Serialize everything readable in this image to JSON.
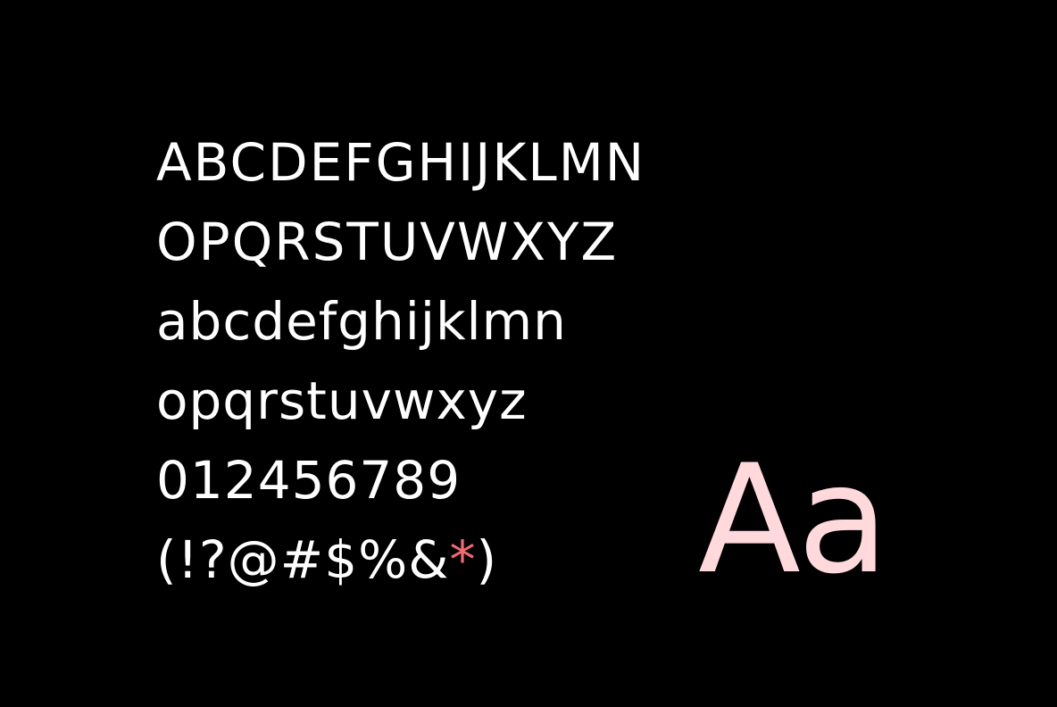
{
  "colors": {
    "background": "#000000",
    "text": "#ffffff",
    "accent": "#f26b73",
    "sample": "#ffd9dc"
  },
  "charset": {
    "uppercase_1": "ABCDEFGHIJKLMN",
    "uppercase_2": "OPQRSTUVWXYZ",
    "lowercase_1": "abcdefghijklmn",
    "lowercase_2": "opqrstuvwxyz",
    "digits": "012456789",
    "symbols_before": "(!?@#$%&",
    "symbols_accent": "*",
    "symbols_after": ")"
  },
  "sample": {
    "text": "Aa"
  }
}
